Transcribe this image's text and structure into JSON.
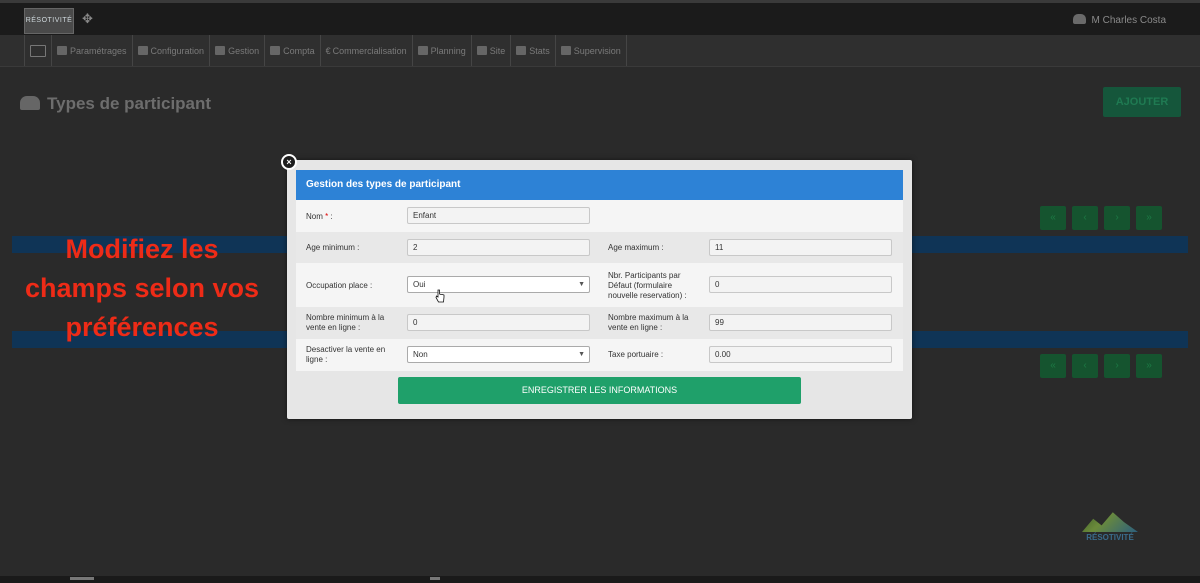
{
  "app": {
    "logo_text": "RÉSOTIVITÉ",
    "user_name": "M Charles Costa"
  },
  "nav": [
    {
      "label": "",
      "icon": "monitor-icon"
    },
    {
      "label": "Paramétrages",
      "icon": "wrench-icon"
    },
    {
      "label": "Configuration",
      "icon": "cogs-icon"
    },
    {
      "label": "Gestion",
      "icon": "list-icon"
    },
    {
      "label": "Compta",
      "icon": "calculator-icon"
    },
    {
      "label": "Commercialisation",
      "icon": "euro-icon"
    },
    {
      "label": "Planning",
      "icon": "calendar-icon"
    },
    {
      "label": "Site",
      "icon": "sitemap-icon"
    },
    {
      "label": "Stats",
      "icon": "chart-icon"
    },
    {
      "label": "Supervision",
      "icon": "eye-icon"
    }
  ],
  "page": {
    "title": "Types de participant",
    "add_button": "AJOUTER"
  },
  "overlay": {
    "line1": "Modifiez les",
    "line2": "champs selon vos",
    "line3": "préférences"
  },
  "modal": {
    "title": "Gestion des types de participant",
    "fields": {
      "nom": {
        "label": "Nom",
        "required_mark": "*",
        "suffix": " :",
        "value": "Enfant"
      },
      "age_min": {
        "label": "Age minimum :",
        "value": "2"
      },
      "age_max": {
        "label": "Age maximum :",
        "value": "11"
      },
      "occupation": {
        "label": "Occupation place :",
        "value": "Oui"
      },
      "nbr_participants": {
        "label_line1": "Nbr. Participants par",
        "label_line2": "Défaut (formulaire",
        "label_line3": "nouvelle reservation) :",
        "value": "0"
      },
      "nb_min_vente": {
        "label_line1": "Nombre minimum à la",
        "label_line2": "vente en ligne :",
        "value": "0"
      },
      "nb_max_vente": {
        "label_line1": "Nombre maximum à la",
        "label_line2": "vente en ligne :",
        "value": "99"
      },
      "desactiver": {
        "label_line1": "Desactiver la vente en",
        "label_line2": "ligne :",
        "value": "Non"
      },
      "taxe": {
        "label": "Taxe portuaire :",
        "value": "0.00"
      }
    },
    "save_button": "ENREGISTRER LES INFORMATIONS"
  },
  "brand": {
    "name": "RÉSOTIVITÉ"
  },
  "colors": {
    "header_blue": "#2d82d6",
    "save_green": "#1fa06a",
    "overlay_red": "#ee2b17"
  }
}
